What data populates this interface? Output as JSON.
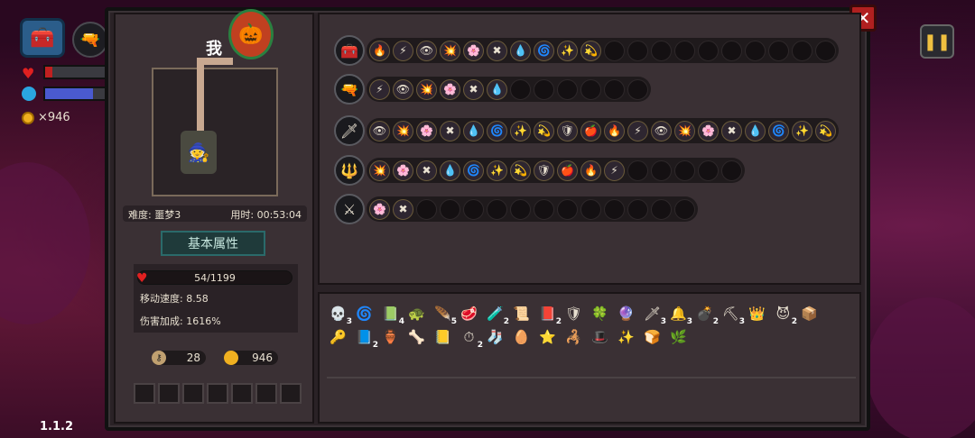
{
  "hud": {
    "gold_count": "×946",
    "version": "1.1.2"
  },
  "panel": {
    "me_label": "我",
    "difficulty_label": "难度: 噩梦3",
    "time_label": "用时: 00:53:04",
    "attr_title": "基本属性",
    "hp": "54/1199",
    "move_speed": "移动速度: 8.58",
    "damage_bonus": "伤害加成: 1616%",
    "keys": "28",
    "coins": "946"
  },
  "weapon_rows": [
    {
      "icon": "🧰",
      "filled": 10,
      "total": 20
    },
    {
      "icon": "🔫",
      "filled": 6,
      "total": 12
    },
    {
      "icon": "🗡",
      "filled": 20,
      "total": 20
    },
    {
      "icon": "🔱",
      "filled": 11,
      "total": 16
    },
    {
      "icon": "⚔",
      "filled": 2,
      "total": 14
    }
  ],
  "items": [
    {
      "g": "💀",
      "n": "3"
    },
    {
      "g": "🌀",
      "n": ""
    },
    {
      "g": "📗",
      "n": "4"
    },
    {
      "g": "🐢",
      "n": ""
    },
    {
      "g": "🪶",
      "n": "5"
    },
    {
      "g": "🥩",
      "n": ""
    },
    {
      "g": "🧪",
      "n": "2"
    },
    {
      "g": "📜",
      "n": ""
    },
    {
      "g": "📕",
      "n": "2"
    },
    {
      "g": "🛡",
      "n": ""
    },
    {
      "g": "🍀",
      "n": ""
    },
    {
      "g": "🔮",
      "n": ""
    },
    {
      "g": "🗡",
      "n": "3"
    },
    {
      "g": "🔔",
      "n": "3"
    },
    {
      "g": "💣",
      "n": "2"
    },
    {
      "g": "⛏",
      "n": "3"
    },
    {
      "g": "👑",
      "n": ""
    },
    {
      "g": "😈",
      "n": "2"
    },
    {
      "g": "📦",
      "n": ""
    },
    {
      "g": "🔑",
      "n": ""
    },
    {
      "g": "📘",
      "n": "2"
    },
    {
      "g": "🏺",
      "n": ""
    },
    {
      "g": "🦴",
      "n": ""
    },
    {
      "g": "📒",
      "n": ""
    },
    {
      "g": "⏱",
      "n": "2"
    },
    {
      "g": "🧦",
      "n": ""
    },
    {
      "g": "🥚",
      "n": ""
    },
    {
      "g": "⭐",
      "n": ""
    },
    {
      "g": "🦂",
      "n": ""
    },
    {
      "g": "🎩",
      "n": ""
    },
    {
      "g": "✨",
      "n": ""
    },
    {
      "g": "🍞",
      "n": ""
    },
    {
      "g": "🌿",
      "n": ""
    }
  ],
  "colors": {
    "panel": "#2a2226",
    "accent": "#c02020",
    "gold": "#f0b020"
  }
}
